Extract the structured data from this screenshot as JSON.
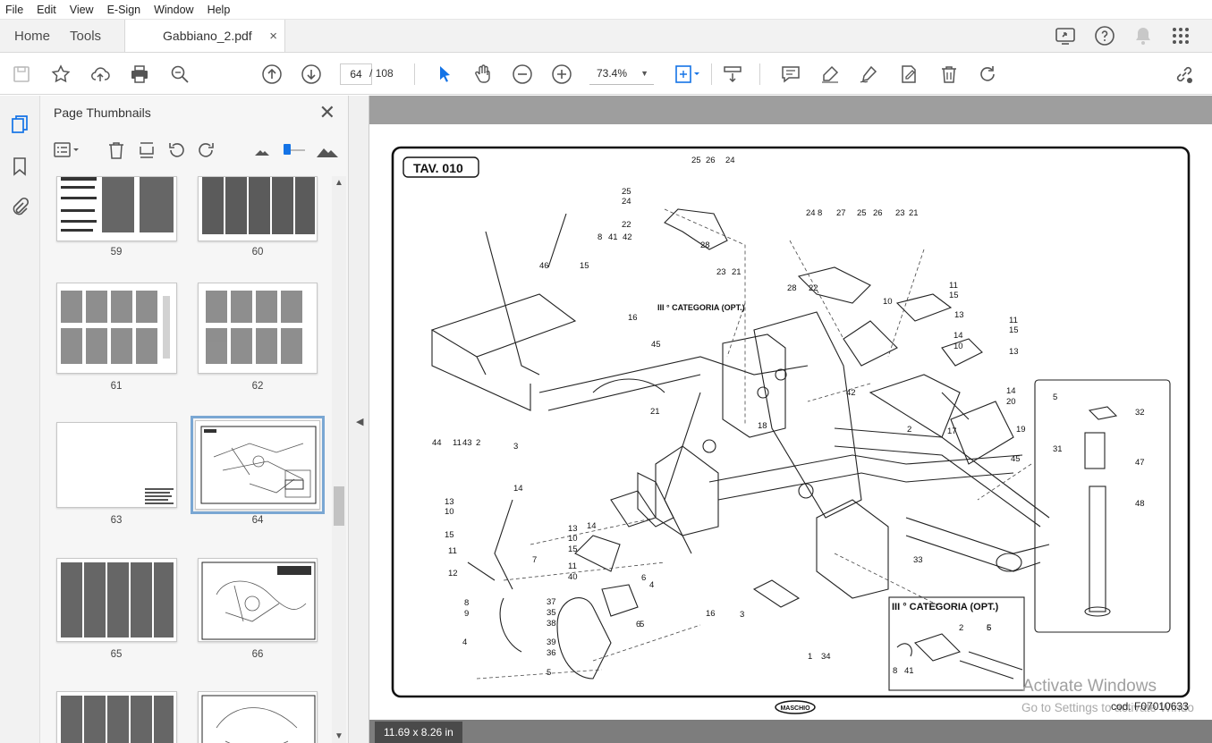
{
  "menu": [
    "File",
    "Edit",
    "View",
    "E-Sign",
    "Window",
    "Help"
  ],
  "tabs": {
    "home": "Home",
    "tools": "Tools",
    "document": "Gabbiano_2.pdf",
    "close": "×"
  },
  "toolbar": {
    "current_page": "64",
    "page_separator": "/",
    "total_pages": "108",
    "zoom": "73.4%"
  },
  "panel": {
    "title": "Page Thumbnails",
    "close": "✕",
    "thumbnails": [
      {
        "label": "59"
      },
      {
        "label": "60"
      },
      {
        "label": "61"
      },
      {
        "label": "62"
      },
      {
        "label": "63"
      },
      {
        "label": "64",
        "selected": true
      },
      {
        "label": "65"
      },
      {
        "label": "66"
      }
    ]
  },
  "page_content": {
    "plate_title": "TAV. 010",
    "category_label_top": "III ° CATEGORIA (OPT.)",
    "category_label_box": "III ° CATEGORIA (OPT.)",
    "brand": "MASCHIO",
    "code": "cod. F07010633",
    "part_numbers": [
      "25",
      "26",
      "24",
      "25",
      "24",
      "22",
      "8",
      "41",
      "42",
      "28",
      "23",
      "21",
      "46",
      "15",
      "16",
      "45",
      "24",
      "8",
      "27",
      "25",
      "26",
      "23",
      "21",
      "28",
      "22",
      "10",
      "11",
      "15",
      "13",
      "14",
      "10",
      "11",
      "15",
      "13",
      "14",
      "20",
      "21",
      "18",
      "19",
      "17",
      "45",
      "44",
      "11",
      "43",
      "2",
      "3",
      "14",
      "13",
      "10",
      "15",
      "11",
      "12",
      "7",
      "8",
      "9",
      "4",
      "14",
      "13",
      "10",
      "15",
      "11",
      "40",
      "37",
      "35",
      "38",
      "39",
      "36",
      "5",
      "6",
      "5",
      "6",
      "4",
      "16",
      "3",
      "2",
      "1",
      "34",
      "33",
      "5",
      "32",
      "31",
      "47",
      "48",
      "2",
      "5",
      "6",
      "8",
      "41",
      "42"
    ]
  },
  "status": {
    "page_size": "11.69 x 8.26 in"
  },
  "overlay": {
    "activate_title": "Activate Windows",
    "activate_sub": "Go to Settings to activate Windo"
  },
  "colors": {
    "accent": "#1473e6",
    "doc_bg": "#7d7d7d",
    "selected_thumb": "#7aa7d3"
  }
}
